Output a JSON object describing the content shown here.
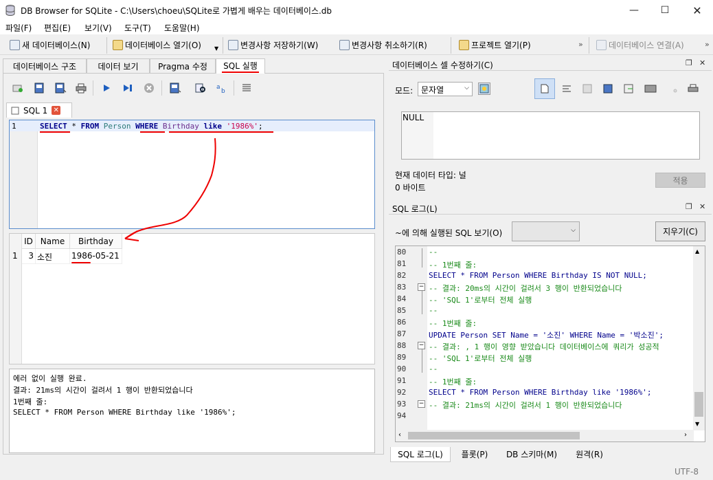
{
  "window": {
    "title": "DB Browser for SQLite - C:\\Users\\choeu\\SQLite로 가볍게 배우는 데이터베이스.db"
  },
  "menu": [
    "파일(F)",
    "편집(E)",
    "보기(V)",
    "도구(T)",
    "도움말(H)"
  ],
  "toolbar": {
    "new_db": "새 데이터베이스(N)",
    "open_db": "데이터베이스 열기(O)",
    "save_changes": "변경사항 저장하기(W)",
    "revert_changes": "변경사항 취소하기(R)",
    "open_project": "프로젝트 열기(P)",
    "attach_db": "데이터베이스 연결(A)"
  },
  "main_tabs": [
    "데이터베이스 구조",
    "데이터 보기",
    "Pragma 수정",
    "SQL 실행"
  ],
  "sql_tab": {
    "label": "SQL 1"
  },
  "editor": {
    "line": "1",
    "tokens": {
      "select": "SELECT",
      "star": "*",
      "from": "FROM",
      "table": "Person",
      "where": "WHERE",
      "col": "Birthday",
      "like": "like",
      "value": "'1986%'",
      "semi": ";"
    }
  },
  "results": {
    "headers": [
      "ID",
      "Name",
      "Birthday"
    ],
    "rows": [
      {
        "rownum": "1",
        "id": "3",
        "name": "소진",
        "birthday": "1986-05-21"
      }
    ]
  },
  "message": {
    "line1": "에러 없이 실행 완료.",
    "line2": "결과: 21ms의 시간이 걸려서 1 행이 반환되었습니다",
    "line3": "1번째 줄:",
    "line4": "SELECT * FROM Person WHERE Birthday like '1986%';"
  },
  "cell_editor": {
    "title": "데이터베이스 셀 수정하기(C)",
    "mode_label": "모드:",
    "mode_value": "문자열",
    "value": "NULL",
    "type_label": "현재 데이터 타입: 널",
    "size_label": "0 바이트",
    "apply": "적용"
  },
  "sql_log": {
    "title": "SQL 로그(L)",
    "filter_label": "~에 의해 실행된 SQL 보기(O)",
    "clear": "지우기(C)",
    "lines": [
      {
        "n": "80",
        "text": "--"
      },
      {
        "n": "81",
        "text": "-- 1번째 줄:"
      },
      {
        "n": "82",
        "text": "SELECT * FROM Person WHERE Birthday IS NOT NULL;"
      },
      {
        "n": "83",
        "text": "-- 결과: 20ms의 시간이 걸려서 3 행이 반환되었습니다"
      },
      {
        "n": "84",
        "text": "-- 'SQL 1'로부터 전체 실행"
      },
      {
        "n": "85",
        "text": "--"
      },
      {
        "n": "86",
        "text": "-- 1번째 줄:"
      },
      {
        "n": "87",
        "text": "UPDATE Person SET Name = '소진' WHERE Name = '박소진';"
      },
      {
        "n": "88",
        "text": "-- 결과: , 1 행이 영향 받았습니다 데이터베이스에 쿼리가 성공적"
      },
      {
        "n": "89",
        "text": "-- 'SQL 1'로부터 전체 실행"
      },
      {
        "n": "90",
        "text": "--"
      },
      {
        "n": "91",
        "text": "-- 1번째 줄:"
      },
      {
        "n": "92",
        "text": "SELECT * FROM Person WHERE Birthday like '1986%';"
      },
      {
        "n": "93",
        "text": "-- 결과: 21ms의 시간이 걸려서 1 행이 반환되었습니다"
      },
      {
        "n": "94",
        "text": ""
      }
    ]
  },
  "bottom_tabs": [
    "SQL 로그(L)",
    "플롯(P)",
    "DB 스키마(M)",
    "원격(R)"
  ],
  "status": {
    "encoding": "UTF-8"
  }
}
